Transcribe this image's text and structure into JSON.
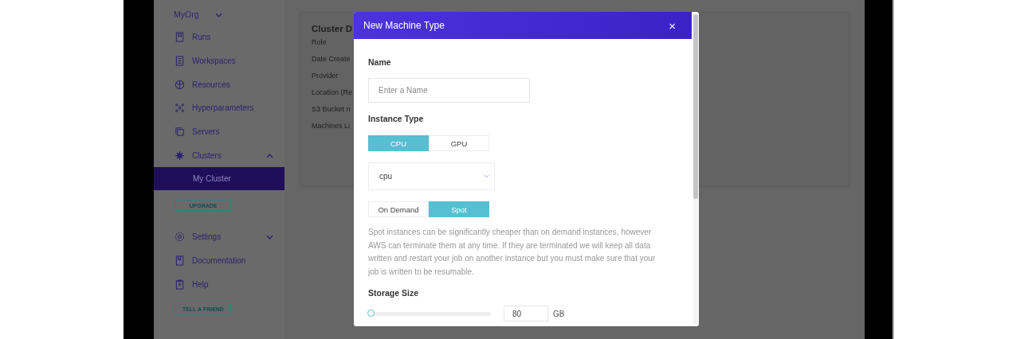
{
  "sidebar": {
    "org": {
      "label": "MyOrg",
      "expanded": false
    },
    "items": [
      {
        "label": "Runs"
      },
      {
        "label": "Workspaces"
      },
      {
        "label": "Resources"
      },
      {
        "label": "Hyperparameters"
      },
      {
        "label": "Servers"
      },
      {
        "label": "Clusters",
        "expanded": true,
        "children": [
          {
            "label": "My Cluster",
            "selected": true
          }
        ]
      }
    ],
    "upgrade_button": "UPGRADE",
    "bottom_items": [
      {
        "label": "Settings",
        "expanded": false
      },
      {
        "label": "Documentation"
      },
      {
        "label": "Help"
      }
    ],
    "tell_button": "TELL A FRIEND"
  },
  "cluster_card": {
    "title": "Cluster D",
    "fields": [
      "Role",
      "Date Create",
      "Provider",
      "Location (Re",
      "S3 Bucket n",
      "Machines Li"
    ]
  },
  "modal": {
    "title": "New Machine Type",
    "close": "×",
    "name": {
      "label": "Name",
      "placeholder": "Enter a Name"
    },
    "instance_type": {
      "label": "Instance Type",
      "options": [
        {
          "label": "CPU",
          "selected": true
        },
        {
          "label": "GPU",
          "selected": false
        }
      ],
      "select_value": "cpu"
    },
    "pricing": {
      "options": [
        {
          "label": "On Demand",
          "selected": false
        },
        {
          "label": "Spot",
          "selected": true
        }
      ],
      "note": "Spot instances can be significantly cheaper than on demand instances, however AWS can terminate them at any time. If they are terminated we will keep all data written and restart your job on another instance but you must make sure that your job is written to be resumable."
    },
    "storage": {
      "label": "Storage Size",
      "level": 0.02,
      "value": "80",
      "unit": "GB"
    }
  }
}
